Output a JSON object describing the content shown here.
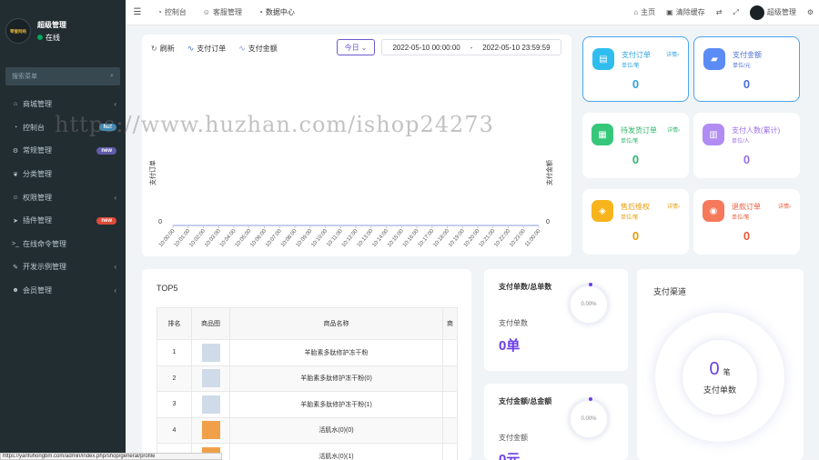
{
  "sidebar": {
    "user": {
      "name": "超级管理",
      "status": "在线",
      "logo_text": "零壹网络"
    },
    "search_placeholder": "搜索菜单",
    "items": [
      {
        "label": "商城管理",
        "icon": "home-icon",
        "glyph": "⌂",
        "arrow": "‹"
      },
      {
        "label": "控制台",
        "icon": "dashboard-icon",
        "glyph": "◔",
        "badge": "hot",
        "badge_color": "#3c8dbc"
      },
      {
        "label": "常规管理",
        "icon": "cogs-icon",
        "glyph": "⚙",
        "badge": "new",
        "badge_color": "#605ca8"
      },
      {
        "label": "分类管理",
        "icon": "leaf-icon",
        "glyph": "❦"
      },
      {
        "label": "权限管理",
        "icon": "group-icon",
        "glyph": "☺",
        "arrow": "‹"
      },
      {
        "label": "插件管理",
        "icon": "rocket-icon",
        "glyph": "➤",
        "badge": "new",
        "badge_color": "#dd4b39"
      },
      {
        "label": "在线命令管理",
        "icon": "terminal-icon",
        "glyph": ">_"
      },
      {
        "label": "开发示例管理",
        "icon": "magic-icon",
        "glyph": "✎",
        "arrow": "‹"
      },
      {
        "label": "会员管理",
        "icon": "user-circle-icon",
        "glyph": "☻",
        "arrow": "‹"
      }
    ]
  },
  "topbar": {
    "tabs": [
      {
        "label": "控制台",
        "glyph": "◔"
      },
      {
        "label": "客服管理",
        "glyph": "☺"
      },
      {
        "label": "数据中心",
        "glyph": "◔"
      }
    ],
    "right": [
      {
        "label": "主页",
        "glyph": "⌂"
      },
      {
        "label": "清除缓存",
        "glyph": "▣"
      }
    ],
    "user_label": "超级管理"
  },
  "chart_toolbar": {
    "refresh": "刷新",
    "legend1": "支付订单",
    "legend2": "支付金额",
    "today": "今日",
    "range_start": "2022-05-10 00:00:00",
    "range_sep": "-",
    "range_end": "2022-05-10 23:59:59"
  },
  "chart_data": {
    "type": "line",
    "ylabel": "支付订单",
    "ylabel_right": "支付金额",
    "x": [
      "10:00:00",
      "10:01:00",
      "10:02:00",
      "10:03:00",
      "10:04:00",
      "10:05:00",
      "10:06:00",
      "10:07:00",
      "10:08:00",
      "10:09:00",
      "10:10:00",
      "10:11:00",
      "10:12:00",
      "10:13:00",
      "10:14:00",
      "10:15:00",
      "10:16:00",
      "10:17:00",
      "10:18:00",
      "10:19:00",
      "10:20:00",
      "10:21:00",
      "10:22:00",
      "10:23:00",
      "11:00:00"
    ],
    "series": [
      {
        "name": "支付订单",
        "color": "#3a7bd5",
        "values": [
          0,
          0,
          0,
          0,
          0,
          0,
          0,
          0,
          0,
          0,
          0,
          0,
          0,
          0,
          0,
          0,
          0,
          0,
          0,
          0,
          0,
          0,
          0,
          0,
          0
        ]
      },
      {
        "name": "支付金额",
        "color": "#8b9ce0",
        "values": [
          0,
          0,
          0,
          0,
          0,
          0,
          0,
          0,
          0,
          0,
          0,
          0,
          0,
          0,
          0,
          0,
          0,
          0,
          0,
          0,
          0,
          0,
          0,
          0,
          0
        ]
      }
    ],
    "y_tick": "0",
    "y_tick_right": "0"
  },
  "stats": [
    {
      "title": "支付订单",
      "unit": "单位/笔",
      "detail": "详情›",
      "value": "0",
      "color": "#2fbdf0",
      "text_color": "#2fa3e0",
      "glyph": "▤",
      "icon": "order-icon"
    },
    {
      "title": "支付金额",
      "unit": "单位/元",
      "detail": "",
      "value": "0",
      "color": "#5b8cf5",
      "text_color": "#4a6fd8",
      "glyph": "▰",
      "icon": "wallet-icon"
    },
    {
      "title": "待发货订单",
      "unit": "单位/笔",
      "detail": "详情›",
      "value": "0",
      "color": "#36c77a",
      "text_color": "#2fb56c",
      "glyph": "▦",
      "icon": "calendar-icon"
    },
    {
      "title": "支付人数(累计)",
      "unit": "单位/人",
      "detail": "",
      "value": "0",
      "color": "#b08cf3",
      "text_color": "#9a6de8",
      "glyph": "▥",
      "icon": "chart-bar-icon"
    },
    {
      "title": "售后维权",
      "unit": "单位/笔",
      "detail": "详情›",
      "value": "0",
      "color": "#f7b41c",
      "text_color": "#e69d0c",
      "glyph": "◈",
      "icon": "shield-icon"
    },
    {
      "title": "退款订单",
      "unit": "单位/笔",
      "detail": "详情›",
      "value": "0",
      "color": "#f5795a",
      "text_color": "#ea5a3a",
      "glyph": "◉",
      "icon": "refund-icon"
    }
  ],
  "top5": {
    "title": "TOP5",
    "headers": [
      "排名",
      "商品图",
      "商品名称",
      "商"
    ],
    "rows": [
      {
        "rank": "1",
        "name": "羊胎素多肽修护冻干粉",
        "thumb": "#cfdbe8"
      },
      {
        "rank": "2",
        "name": "羊胎素多肽修护冻干粉(0)",
        "thumb": "#cfdbe8"
      },
      {
        "rank": "3",
        "name": "羊胎素多肽修护冻干粉(1)",
        "thumb": "#cfdbe8"
      },
      {
        "rank": "4",
        "name": "活肌水(0)(0)",
        "thumb": "#f0a04a"
      },
      {
        "rank": "5",
        "name": "活肌水(0)(1)",
        "thumb": "#f0a04a"
      }
    ]
  },
  "ratio_count": {
    "title": "支付单数/总单数",
    "label": "支付单数",
    "value": "0单",
    "percent": "0.00%"
  },
  "ratio_amount": {
    "title": "支付金额/总金额",
    "label": "支付金额",
    "value": "0元",
    "percent": "0.00%"
  },
  "channel": {
    "title": "支付渠道",
    "num": "0",
    "unit": "笔",
    "label": "支付单数"
  },
  "watermark": "https://www.huzhan.com/ishop24273",
  "statusbar": "https://yanfuhongbm.com/admin/index.php/shop/general/profile"
}
